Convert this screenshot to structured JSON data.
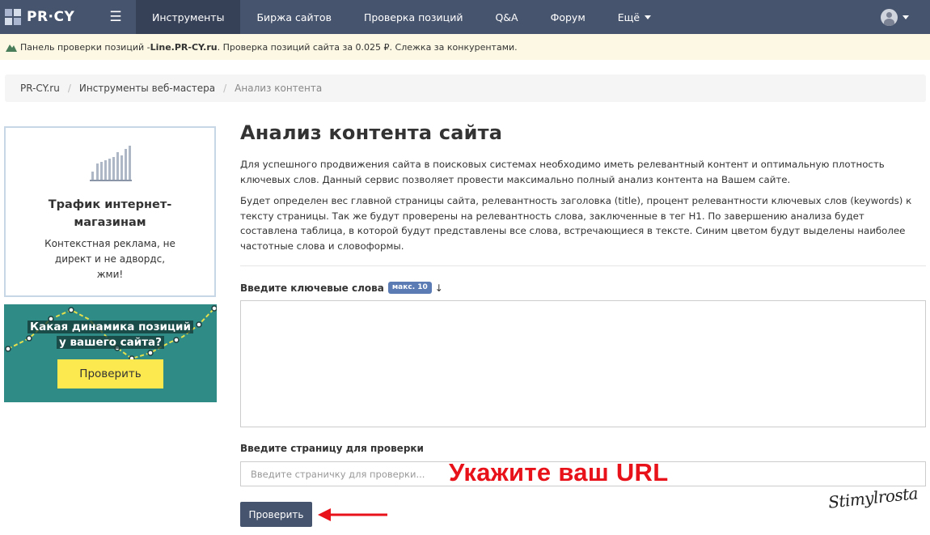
{
  "navbar": {
    "logo": "PR·CY",
    "items": [
      "Инструменты",
      "Биржа сайтов",
      "Проверка позиций",
      "Q&A",
      "Форум",
      "Ещё"
    ],
    "colors": {
      "bg": "#47546e",
      "active": "#364057"
    }
  },
  "notice": {
    "prefix": "Панель проверки позиций - ",
    "link": "Line.PR-CY.ru",
    "suffix": ". Проверка позиций сайта за 0.025 ₽. Слежка за конкурентами."
  },
  "breadcrumb": {
    "items": [
      "PR-CY.ru",
      "Инструменты веб-мастера"
    ],
    "current": "Анализ контента",
    "separator": "/"
  },
  "ad": {
    "title_line1": "Трафик интернет-",
    "title_line2": "магазинам",
    "desc_line1": "Контекстная реклама, не",
    "desc_line2": "директ и не адвордс,",
    "desc_line3": "жми!"
  },
  "promo": {
    "line1": "Какая динамика позиций",
    "line2": "у вашего сайта?",
    "button": "Проверить",
    "colors": {
      "bg": "#2f8b85",
      "button": "#fce84f"
    }
  },
  "main": {
    "title": "Анализ контента сайта",
    "para1": "Для успешного продвижения сайта в поисковых системах необходимо иметь релевантный контент и оптимальную плотность ключевых слов. Данный сервис позволяет провести максимально полный анализ контента на Вашем сайте.",
    "para2": "Будет определен вес главной страницы сайта, релевантность заголовка (title), процент релевантности ключевых слов (keywords) к тексту страницы. Так же будут проверены на релевантность слова, заключенные в тег H1. По завершению анализа будет составлена таблица, в которой будут представлены все слова, встречающиеся в тексте. Синим цветом будут выделены наиболее частотные слова и словоформы.",
    "keywords_label": "Введите ключевые слова",
    "keywords_badge": "макс. 10",
    "keywords_arrow": "↓",
    "keywords_value": "",
    "url_label": "Введите страницу для проверки",
    "url_placeholder": "Введите страничку для проверки...",
    "url_value": "",
    "url_hint": "Укажите ваш URL",
    "submit": "Проверить",
    "colors": {
      "hint": "#e8121b",
      "badge": "#5b7bb5",
      "submit": "#47546e"
    }
  },
  "signature": "Stimylrosta"
}
